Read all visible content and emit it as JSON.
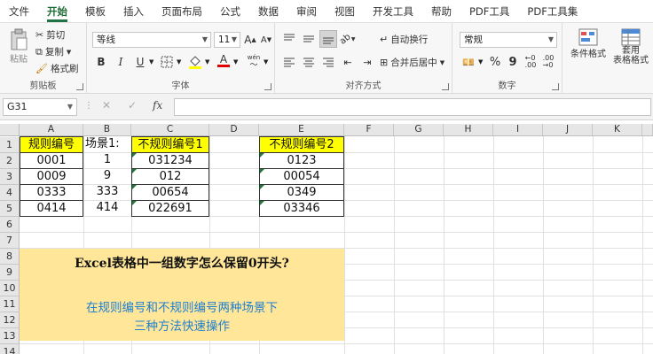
{
  "menu": {
    "tabs": [
      "文件",
      "开始",
      "模板",
      "插入",
      "页面布局",
      "公式",
      "数据",
      "审阅",
      "视图",
      "开发工具",
      "帮助",
      "PDF工具",
      "PDF工具集"
    ]
  },
  "ribbon": {
    "clipboard": {
      "paste": "粘贴",
      "cut": "剪切",
      "copy": "复制",
      "format_painter": "格式刷",
      "label": "剪贴板"
    },
    "font": {
      "font_name": "等线",
      "font_size": "11",
      "grow": "A",
      "shrink": "A",
      "bold": "B",
      "italic": "I",
      "underline": "U",
      "font_color_letter": "A",
      "phonetic": "wén",
      "label": "字体"
    },
    "alignment": {
      "wrap_text": "自动换行",
      "merge_center": "合并后居中",
      "label": "对齐方式"
    },
    "number": {
      "format": "常规",
      "percent": "%",
      "comma": "9",
      "label": "数字"
    },
    "styles": {
      "conditional": "条件格式",
      "table_format_1": "套用",
      "table_format_2": "表格格式"
    }
  },
  "formula_bar": {
    "name_box": "G31",
    "cancel": "✕",
    "enter": "✓",
    "fx": "fx",
    "value": ""
  },
  "columns": [
    "A",
    "B",
    "C",
    "D",
    "E",
    "F",
    "G",
    "H",
    "I",
    "J",
    "K"
  ],
  "rows": [
    "1",
    "2",
    "3",
    "4",
    "5",
    "6",
    "7",
    "8",
    "9",
    "10",
    "11",
    "12",
    "13",
    "14"
  ],
  "cells": {
    "A1": "规则编号",
    "A2": "0001",
    "A3": "0009",
    "A4": "0333",
    "A5": "0414",
    "B1": "场景1:",
    "B2": "1",
    "B3": "9",
    "B4": "333",
    "B5": "414",
    "C1": "不规则编号1",
    "C2": "031234",
    "C3": "012",
    "C4": "00654",
    "C5": "022691",
    "E1": "不规则编号2",
    "E2": "0123",
    "E3": "00054",
    "E4": "0349",
    "E5": "03346"
  },
  "note": {
    "line1": "Excel表格中一组数字怎么保留0开头?",
    "line2": "在规则编号和不规则编号两种场景下",
    "line3": "三种方法快速操作"
  },
  "colors": {
    "accent": "#217346",
    "highlight": "#ffff00",
    "note_bg": "#ffe699",
    "note_text": "#1f7fd1"
  }
}
